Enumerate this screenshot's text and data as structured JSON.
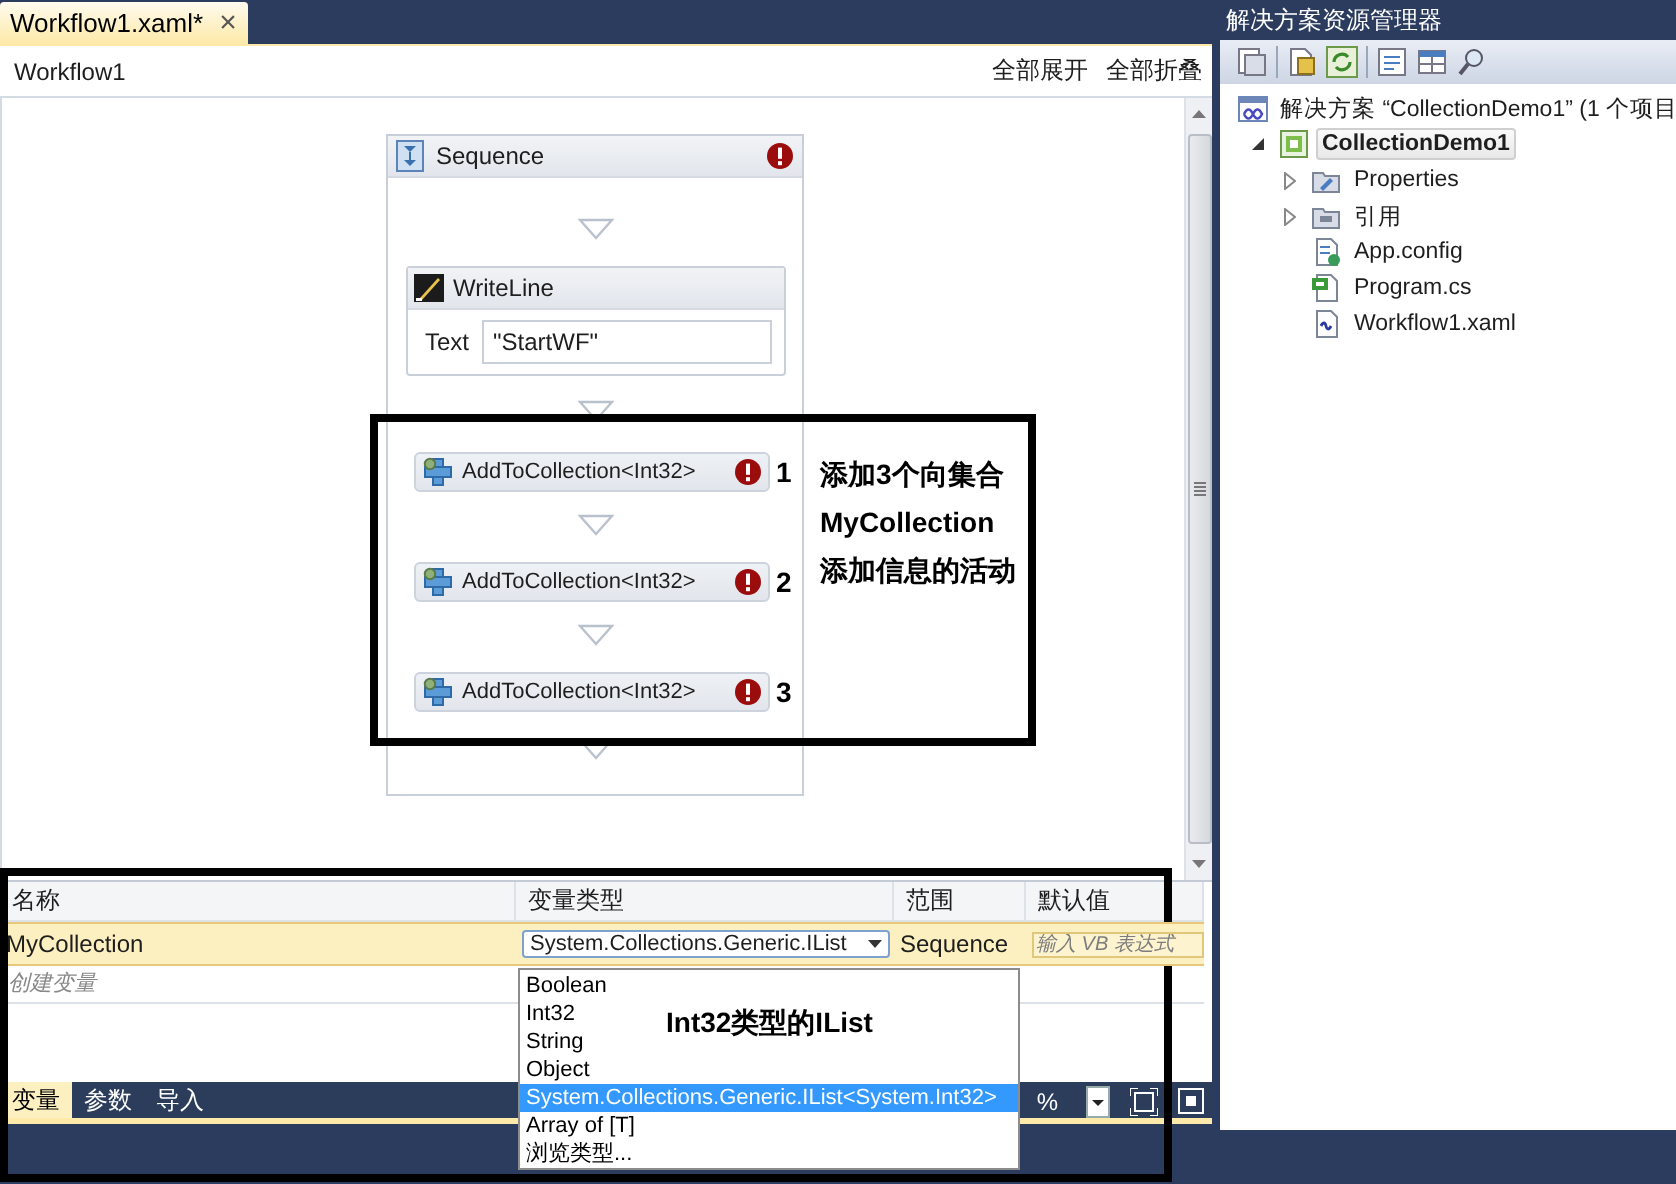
{
  "tab": {
    "title": "Workflow1.xaml*",
    "close": "×"
  },
  "breadcrumb": "Workflow1",
  "header_links": [
    "全部展开",
    "全部折叠"
  ],
  "sequence": {
    "title": "Sequence",
    "error": true,
    "writeline": {
      "title": "WriteLine",
      "field_label": "Text",
      "value": "\"StartWF\""
    },
    "activities": [
      {
        "title": "AddToCollection<Int32>",
        "error": true,
        "note": "1"
      },
      {
        "title": "AddToCollection<Int32>",
        "error": true,
        "note": "2"
      },
      {
        "title": "AddToCollection<Int32>",
        "error": true,
        "note": "3"
      }
    ]
  },
  "activities_annotation": [
    "添加3个向集合",
    "MyCollection",
    "添加信息的活动"
  ],
  "variables": {
    "columns": [
      "名称",
      "变量类型",
      "范围",
      "默认值"
    ],
    "rows": [
      {
        "name": "MyCollection",
        "type": "System.Collections.Generic.IList",
        "scope": "Sequence",
        "default_placeholder": "输入 VB 表达式",
        "selected": true
      }
    ],
    "create_placeholder": "创建变量"
  },
  "type_dropdown": {
    "options": [
      {
        "label": "Boolean",
        "selected": false
      },
      {
        "label": "Int32",
        "selected": false
      },
      {
        "label": "String",
        "selected": false
      },
      {
        "label": "Object",
        "selected": false
      },
      {
        "label": "System.Collections.Generic.IList<System.Int32>",
        "selected": true
      },
      {
        "label": "Array of [T]",
        "selected": false
      },
      {
        "label": "浏览类型...",
        "selected": false
      }
    ],
    "annotation": "Int32类型的IList"
  },
  "bottom_tabs": [
    {
      "label": "变量",
      "selected": true
    },
    {
      "label": "参数",
      "selected": false
    },
    {
      "label": "导入",
      "selected": false
    }
  ],
  "zoom_text": "%",
  "solution_explorer": {
    "title": "解决方案资源管理器",
    "tree": [
      {
        "label": "解决方案 “CollectionDemo1” (1 个项目",
        "kind": "solution",
        "children": [
          {
            "label": "CollectionDemo1",
            "kind": "project",
            "selected": true,
            "expanded": true,
            "children": [
              {
                "label": "Properties",
                "kind": "properties",
                "selected": false,
                "expanded": false
              },
              {
                "label": "引用",
                "kind": "references",
                "selected": false,
                "expanded": false
              },
              {
                "label": "App.config",
                "kind": "config",
                "selected": false
              },
              {
                "label": "Program.cs",
                "kind": "cs",
                "selected": false
              },
              {
                "label": "Workflow1.xaml",
                "kind": "xaml",
                "selected": false
              }
            ]
          }
        ]
      }
    ]
  }
}
